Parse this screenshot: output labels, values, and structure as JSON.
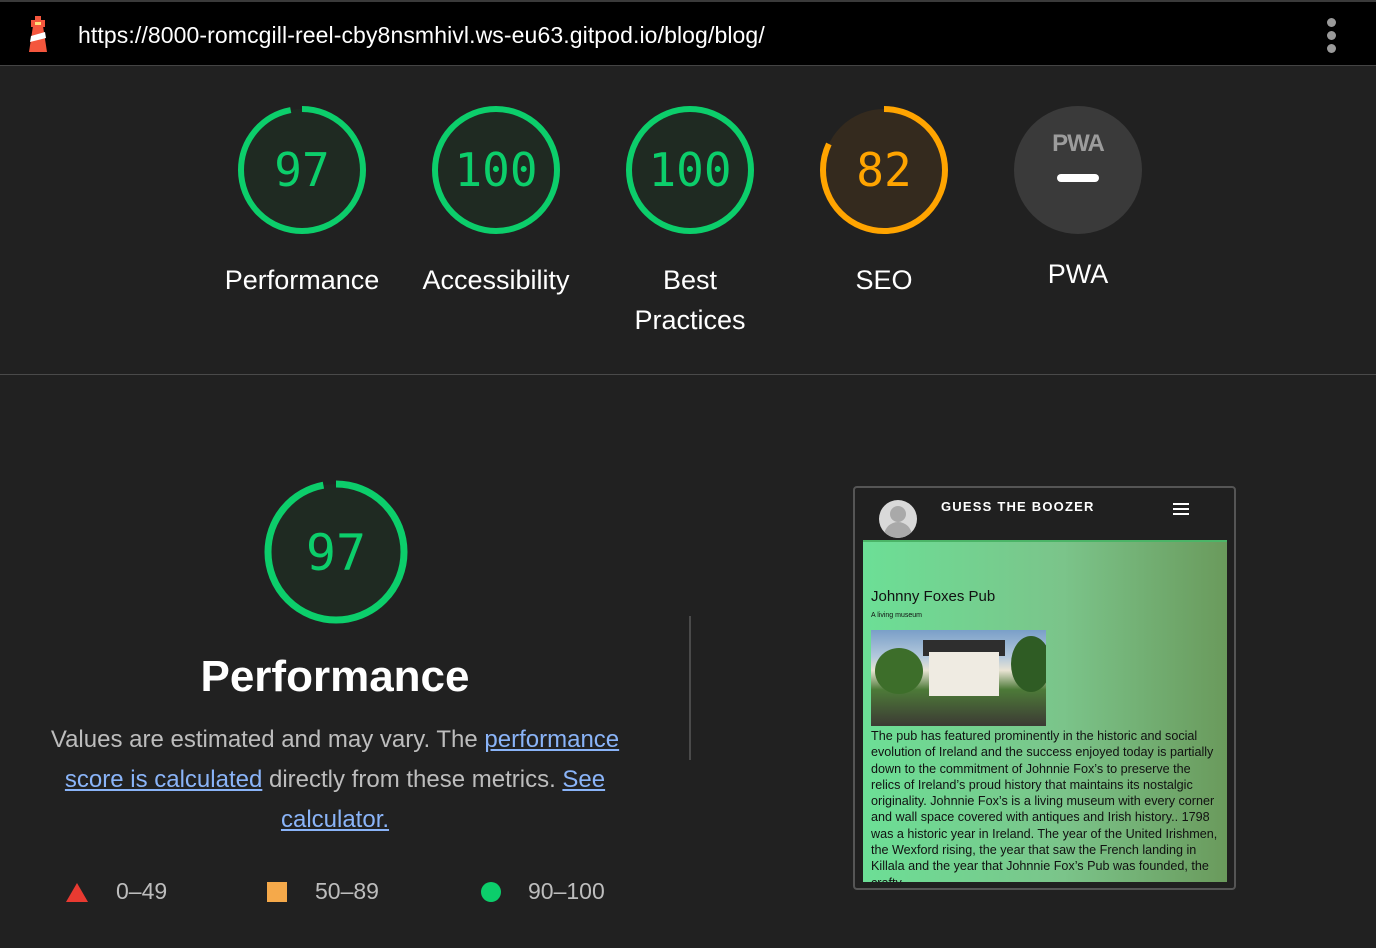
{
  "browser": {
    "url": "https://8000-romcgill-reel-cby8nsmhivl.ws-eu63.gitpod.io/blog/blog/",
    "logo_icon": "lighthouse-icon",
    "menu_icon": "kebab-menu-icon"
  },
  "scores": [
    {
      "label": "Performance",
      "value": "97",
      "fraction": 0.97,
      "color": "#0cce6b"
    },
    {
      "label": "Accessibility",
      "value": "100",
      "fraction": 1.0,
      "color": "#0cce6b"
    },
    {
      "label": "Best Practices",
      "value": "100",
      "fraction": 1.0,
      "color": "#0cce6b"
    },
    {
      "label": "SEO",
      "value": "82",
      "fraction": 0.82,
      "color": "#ffa400"
    }
  ],
  "pwa": {
    "badge_text": "PWA",
    "label": "PWA"
  },
  "performance": {
    "score": "97",
    "fraction": 0.97,
    "title": "Performance",
    "desc_before": "Values are estimated and may vary. The ",
    "desc_link1": "performance score is calculated",
    "desc_middle": " directly from these metrics. ",
    "desc_link2": "See calculator."
  },
  "legend": [
    {
      "range": "0–49",
      "color": "#e93a31",
      "shape": "triangle"
    },
    {
      "range": "50–89",
      "color": "#f5a94a",
      "shape": "square"
    },
    {
      "range": "90–100",
      "color": "#0cce6b",
      "shape": "circle"
    }
  ],
  "screenshot": {
    "brand": "GUESS THE BOOZER",
    "title": "Johnny Foxes Pub",
    "subtitle": "A living museum",
    "body": "The pub has featured prominently in the historic and social evolution of Ireland and the success enjoyed today is partially down to the commitment of Johnnie Fox’s to preserve the relics of Ireland’s proud history that maintains its nostalgic originality. Johnnie Fox’s is a living museum with every corner and wall space covered with antiques and Irish history.. 1798 was a historic year in Ireland. The year of the United Irishmen, the Wexford rising, the year that saw the French landing in Killala and the year that Johnnie Fox’s Pub was founded, the crafty"
  }
}
